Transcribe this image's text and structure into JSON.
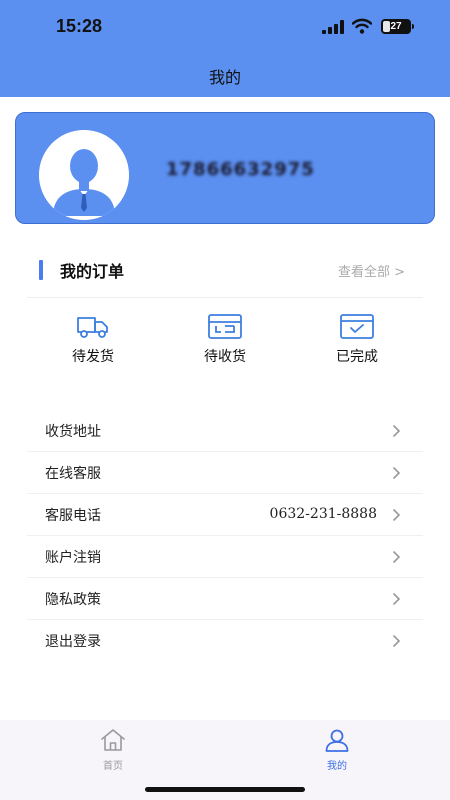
{
  "status_bar": {
    "time": "15:28",
    "battery": "27",
    "battery_level": 0.27
  },
  "header": {
    "title": "我的"
  },
  "profile": {
    "phone": "17866632975",
    "avatar_icon": "user-avatar-icon"
  },
  "orders": {
    "title": "我的订单",
    "view_all": "查看全部 >",
    "statuses": [
      {
        "label": "待发货",
        "icon": "truck-icon"
      },
      {
        "label": "待收货",
        "icon": "package-icon"
      },
      {
        "label": "已完成",
        "icon": "completed-box-icon"
      }
    ]
  },
  "menu": [
    {
      "label": "收货地址",
      "value": ""
    },
    {
      "label": "在线客服",
      "value": ""
    },
    {
      "label": "客服电话",
      "value": "0632-231-8888"
    },
    {
      "label": "账户注销",
      "value": ""
    },
    {
      "label": "隐私政策",
      "value": ""
    },
    {
      "label": "退出登录",
      "value": ""
    }
  ],
  "tabbar": {
    "items": [
      {
        "label": "首页",
        "icon": "home-icon",
        "active": false
      },
      {
        "label": "我的",
        "icon": "profile-icon",
        "active": true
      }
    ]
  },
  "colors": {
    "primary": "#5b8ff0",
    "accent": "#4a7ef0",
    "icon_blue": "#3d7fe0",
    "tab_active": "#3d6fe6",
    "tab_inactive": "#9a9a9a"
  }
}
